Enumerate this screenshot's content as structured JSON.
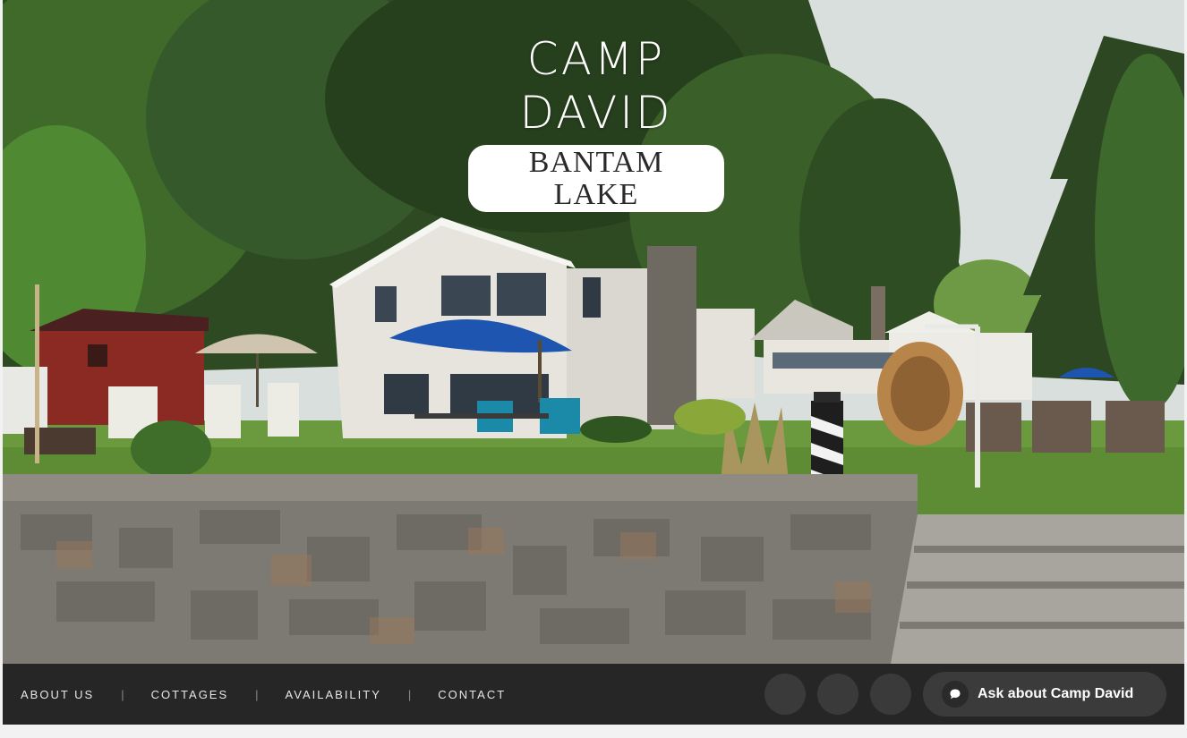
{
  "logo": {
    "title": "CAMP DAVID",
    "subtitle": "BANTAM LAKE"
  },
  "nav": {
    "links": [
      "ABOUT US",
      "COTTAGES",
      "AVAILABILITY",
      "CONTACT"
    ],
    "separator": "|"
  },
  "chat": {
    "label": "Ask about Camp David",
    "icon": "chat-bubble-icon"
  },
  "colors": {
    "nav_background": "#262626",
    "chat_button": "#3b3b3b",
    "umbrella_blue": "#1d55b0",
    "shed_red": "#8a2a22"
  }
}
